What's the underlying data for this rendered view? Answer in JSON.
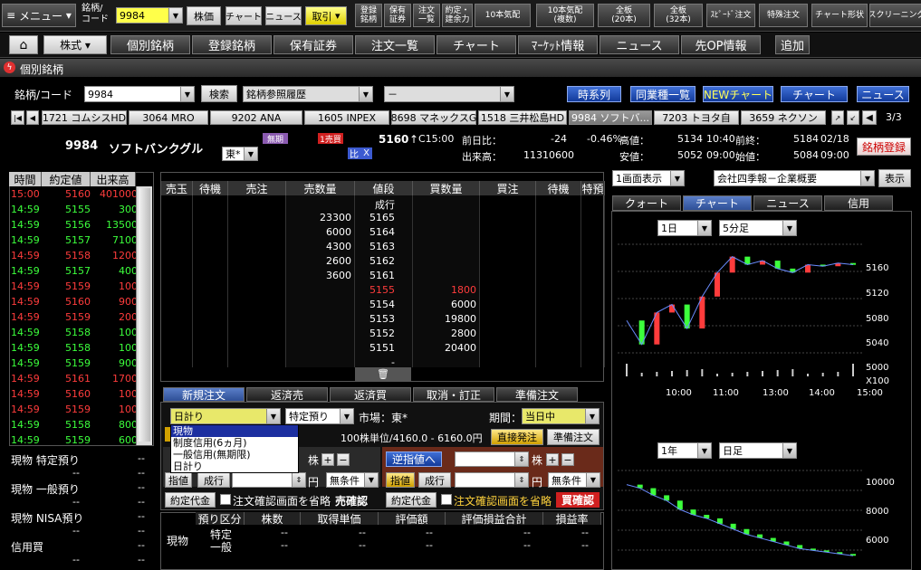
{
  "top": {
    "menu": "メニュー",
    "code_label": "銘柄/\nコード",
    "code_value": "9984",
    "stock_price": "株価",
    "chart": "チャート",
    "news": "ニュース",
    "trade": "取引",
    "tools": [
      "登録\n銘柄",
      "保有\n証券",
      "注文\n一覧",
      "約定・\n建余力",
      "10本気配",
      "10本気配\n(複数)",
      "全板\n(20本)",
      "全板\n(32本)",
      "ｽﾋﾟｰﾄﾞ注文",
      "特殊注文",
      "チャート形状",
      "スクリーニング"
    ]
  },
  "nav": {
    "home": "⌂",
    "kabushiki": "株式",
    "items": [
      "個別銘柄",
      "登録銘柄",
      "保有証券",
      "注文一覧",
      "チャート",
      "ﾏｰｹｯﾄ情報",
      "ニュース",
      "先OP情報"
    ],
    "add": "追加"
  },
  "window_title": "個別銘柄",
  "search": {
    "label": "銘柄/コード",
    "code": "9984",
    "search_btn": "検索",
    "history": "銘柄参照履歴",
    "history2": "－",
    "timeseries": "時系列",
    "peers": "同業種一覧",
    "newchart": "NEWチャート",
    "chart": "チャート",
    "news": "ニュース"
  },
  "tickers": [
    "1721 コムシスHD",
    "3064 MRO",
    "9202 ANA",
    "1605 INPEX",
    "8698 マネックスG",
    "1518 三井松島HD",
    "9984 ソフトバ...",
    "7203 トヨタ自",
    "3659 ネクソン"
  ],
  "ticker_page": "3/3",
  "quote": {
    "code": "9984",
    "name": "ソフトバンクグル",
    "market": "東*",
    "tag1": "無期",
    "tag2": "1売買",
    "hi": "比",
    "x": "X",
    "price": "5160",
    "arrow": "↑",
    "ctime": "C15:00",
    "prev_label": "前日比：",
    "change": "-24",
    "change_pct": "-0.46%",
    "high_label": "高値：",
    "high": "5134",
    "high_time": "10:40",
    "close_label": "前終：",
    "close": "5184",
    "close_date": "02/18",
    "vol_label": "出来高：",
    "volume": "11310600",
    "low_label": "安値：",
    "low": "5052",
    "low_time": "09:00",
    "open_label": "始値：",
    "open": "5084",
    "open_time": "09:00",
    "register": "銘柄登録"
  },
  "ticks": {
    "headers": [
      "時間",
      "約定値",
      "出来高"
    ],
    "rows": [
      [
        "15:00",
        "5160",
        "401000",
        "r"
      ],
      [
        "14:59",
        "5155",
        "300",
        "g"
      ],
      [
        "14:59",
        "5156",
        "13500",
        "g"
      ],
      [
        "14:59",
        "5157",
        "7100",
        "g"
      ],
      [
        "14:59",
        "5158",
        "1200",
        "r"
      ],
      [
        "14:59",
        "5157",
        "400",
        "g"
      ],
      [
        "14:59",
        "5159",
        "100",
        "r"
      ],
      [
        "14:59",
        "5160",
        "900",
        "r"
      ],
      [
        "14:59",
        "5159",
        "200",
        "r"
      ],
      [
        "14:59",
        "5158",
        "100",
        "g"
      ],
      [
        "14:59",
        "5158",
        "100",
        "g"
      ],
      [
        "14:59",
        "5159",
        "900",
        "g"
      ],
      [
        "14:59",
        "5161",
        "1700",
        "r"
      ],
      [
        "14:59",
        "5160",
        "100",
        "r"
      ],
      [
        "14:59",
        "5159",
        "100",
        "r"
      ],
      [
        "14:59",
        "5158",
        "800",
        "g"
      ],
      [
        "14:59",
        "5159",
        "600",
        "g"
      ]
    ]
  },
  "holdings": [
    {
      "label": "現物 特定預り",
      "v": "--"
    },
    {
      "label": "現物 一般預り",
      "v": "--"
    },
    {
      "label": "現物 NISA預り",
      "v": "--"
    },
    {
      "label": "信用買",
      "v": "--"
    }
  ],
  "board": {
    "headers": [
      "売玉",
      "待機",
      "売注",
      "売数量",
      "値段",
      "買数量",
      "買注",
      "待機",
      "特預"
    ],
    "nari": "成行",
    "rows": [
      [
        "23300",
        "5165",
        ""
      ],
      [
        "6000",
        "5164",
        ""
      ],
      [
        "4300",
        "5163",
        ""
      ],
      [
        "2600",
        "5162",
        ""
      ],
      [
        "3600",
        "5161",
        ""
      ],
      [
        "",
        "5155",
        "1800"
      ],
      [
        "",
        "5154",
        "6000"
      ],
      [
        "",
        "5153",
        "19800"
      ],
      [
        "",
        "5152",
        "2800"
      ],
      [
        "",
        "5151",
        "20400"
      ],
      [
        "",
        "-",
        ""
      ]
    ]
  },
  "order": {
    "tabs": [
      "新規注文",
      "返済売",
      "返済買",
      "取消・訂正",
      "準備注文"
    ],
    "type": "日計り",
    "account": "特定預り",
    "market": "市場：東*",
    "period_label": "期間：",
    "period": "当日中",
    "unit": "100株単位/4160.0 - 6160.0円",
    "direct": "直接発注",
    "prepare": "準備注文",
    "dropdown": [
      "現物",
      "制度信用(6ヵ月)",
      "一般信用(無期限)",
      "日計り"
    ],
    "stock": "株",
    "yen": "円",
    "gyaku": "逆指値へ",
    "shisashi": "指値",
    "nariyuki": "成行",
    "joken": "無条件",
    "yakujo": "約定代金",
    "confirm": "注文確認画面を省略",
    "sell_confirm": "売確認",
    "buy_confirm": "買確認"
  },
  "positions": {
    "headers": [
      "預り区分",
      "株数",
      "取得単価",
      "評価額",
      "評価損益合計",
      "損益率"
    ],
    "side": "現物",
    "rows": [
      {
        "k": "特定",
        "v": [
          "--",
          "--",
          "--",
          "--",
          "--"
        ]
      },
      {
        "k": "一般",
        "v": [
          "--",
          "--",
          "--",
          "--",
          "--"
        ]
      }
    ]
  },
  "right": {
    "display": "1画面表示",
    "profile": "会社四季報－企業概要",
    "show": "表示",
    "tabs": [
      "クォート",
      "チャート",
      "ニュース",
      "信用"
    ],
    "period1": "1日",
    "interval1": "5分足",
    "period2": "1年",
    "interval2": "日足",
    "yaxis1": [
      "5160",
      "5120",
      "5080",
      "5040",
      "5000",
      "X100"
    ],
    "xaxis1": [
      "10:00",
      "11:00",
      "13:00",
      "14:00",
      "15:00"
    ],
    "yaxis2": [
      "10000",
      "8000",
      "6000"
    ]
  },
  "chart_data": [
    {
      "type": "line",
      "title": "",
      "series": [
        {
          "name": "",
          "values": [
            5090,
            5060,
            5100,
            5110,
            5080,
            5120,
            5150,
            5170,
            5160,
            5165,
            5155,
            5150,
            5160,
            5158,
            5162,
            5160
          ]
        }
      ],
      "ylim": [
        5020,
        5190
      ]
    },
    {
      "type": "line",
      "title": "",
      "series": [
        {
          "name": "",
          "values": [
            9800,
            9600,
            9200,
            8900,
            8400,
            8100,
            7900,
            7600,
            7300,
            7000,
            6800,
            6600,
            6400,
            6200,
            6100,
            6000,
            5900,
            5800
          ]
        }
      ],
      "ylim": [
        5200,
        10800
      ]
    }
  ]
}
